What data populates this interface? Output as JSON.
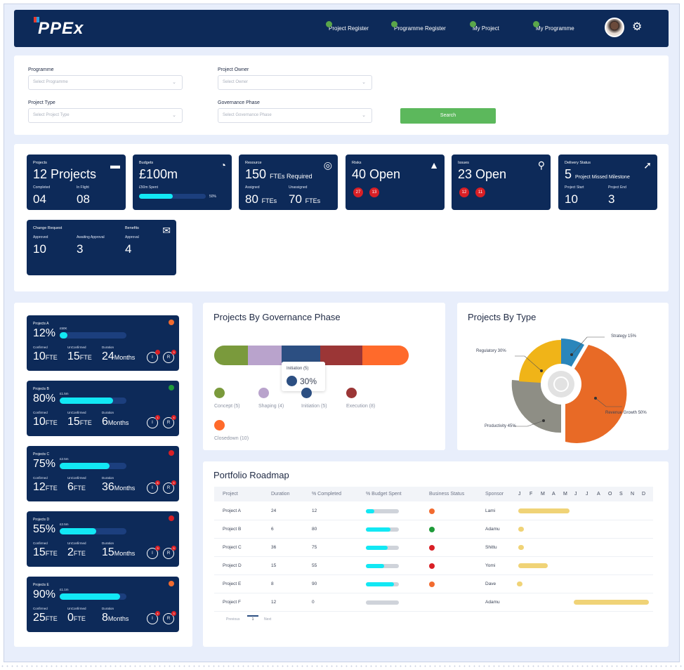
{
  "header": {
    "logo": "PPEx",
    "nav": [
      {
        "label": "Project Register"
      },
      {
        "label": "Programme Register"
      },
      {
        "label": "My Project"
      },
      {
        "label": "My Programme"
      }
    ]
  },
  "filters": {
    "programme": {
      "label": "Programme",
      "placeholder": "Select Programme"
    },
    "project_owner": {
      "label": "Project Owner",
      "placeholder": "Select Owner"
    },
    "project_type": {
      "label": "Project Type",
      "placeholder": "Select Project Type"
    },
    "governance_phase": {
      "label": "Governance Phase",
      "placeholder": "Select Governance Phase"
    },
    "search_label": "Search"
  },
  "kpis": {
    "projects": {
      "title": "Projects",
      "value": "12 Projects",
      "completed_label": "Completed",
      "completed": "04",
      "inflight_label": "In Flight",
      "inflight": "08"
    },
    "budgets": {
      "title": "Budgets",
      "value": "£100m",
      "spent_label": "£50m Spent",
      "spent_pct_label": "50%",
      "spent_fraction": 0.5
    },
    "resource": {
      "title": "Resource",
      "value": "150",
      "value_unit": "FTEs Required",
      "assigned_label": "Assigned",
      "assigned": "80",
      "assigned_unit": "FTEs",
      "unassigned_label": "Unassigned",
      "unassigned": "70",
      "unassigned_unit": "FTEs"
    },
    "risks": {
      "title": "Risks",
      "value": "40 Open",
      "badge1": "27",
      "badge2": "13"
    },
    "issues": {
      "title": "Issues",
      "value": "23 Open",
      "badge1": "12",
      "badge2": "11"
    },
    "delivery": {
      "title": "Delivery Status",
      "value": "5",
      "value_unit": "Project Missed Milestone",
      "start_label": "Project Start",
      "start": "10",
      "end_label": "Project End",
      "end": "3"
    },
    "change": {
      "title": "Change Request",
      "approved_label": "Approved",
      "approved": "10",
      "awaiting_label": "Awaiting Approval",
      "awaiting": "3",
      "benefits_title": "Benefits",
      "benefits_approval_label": "Approval",
      "benefits": "4"
    }
  },
  "project_cards": [
    {
      "name": "Projects A",
      "pct": "12%",
      "fraction": 0.12,
      "amount": "£50K",
      "confirmed": "10",
      "unconfirmed": "15",
      "duration": "24",
      "status_color": "#f26b2f",
      "i_badge": "",
      "r_badge": "3"
    },
    {
      "name": "Projects B",
      "pct": "80%",
      "fraction": 0.8,
      "amount": "£1.5m",
      "confirmed": "10",
      "unconfirmed": "15",
      "duration": "6",
      "status_color": "#1f9b3a",
      "i_badge": "1",
      "r_badge": "4"
    },
    {
      "name": "Projects C",
      "pct": "75%",
      "fraction": 0.75,
      "amount": "£2.5m",
      "confirmed": "12",
      "unconfirmed": "6",
      "duration": "36",
      "status_color": "#d91f25",
      "i_badge": "8",
      "r_badge": "5"
    },
    {
      "name": "Projects D",
      "pct": "55%",
      "fraction": 0.55,
      "amount": "£2.5m",
      "confirmed": "15",
      "unconfirmed": "2",
      "duration": "15",
      "status_color": "#d91f25",
      "i_badge": "3",
      "r_badge": "5"
    },
    {
      "name": "Projects E",
      "pct": "90%",
      "fraction": 0.9,
      "amount": "£1.1m",
      "confirmed": "25",
      "unconfirmed": "0",
      "duration": "8",
      "status_color": "#f26b2f",
      "i_badge": "4",
      "r_badge": "3"
    }
  ],
  "card_labels": {
    "confirmed": "Confirmed",
    "unconfirmed": "UnConfirmed",
    "duration": "Duration",
    "fte": "FTE",
    "months": "Months",
    "i": "I",
    "r": "R"
  },
  "governance": {
    "title": "Projects By Governance Phase",
    "tooltip_label": "Initiation (5)",
    "tooltip_value": "30%",
    "phases": [
      {
        "label": "Concept (5)",
        "color": "#7a9a3c"
      },
      {
        "label": "Shaping (4)",
        "color": "#b9a3cc"
      },
      {
        "label": "Initiation (5)",
        "color": "#2c4f82"
      },
      {
        "label": "Execution (8)",
        "color": "#9b3636"
      },
      {
        "label": "Closedown (10)",
        "color": "#ff6a2b"
      }
    ]
  },
  "types": {
    "title": "Projects By Type",
    "labels": {
      "strategy": "Strategy 15%",
      "regulatory": "Regulatory 30%",
      "revenue": "Revenue Growth 50%",
      "productivity": "Productivity 45%"
    }
  },
  "roadmap": {
    "title": "Portfolio Roadmap",
    "headers": [
      "Project",
      "Duration",
      "% Completed",
      "% Budget Spent",
      "Business Status",
      "Sponsor"
    ],
    "months": [
      "J",
      "F",
      "M",
      "A",
      "M",
      "J",
      "J",
      "A",
      "O",
      "S",
      "N",
      "D"
    ],
    "rows": [
      {
        "project": "Project A",
        "duration": "24",
        "completed": "12",
        "budget_fraction": 0.25,
        "status_color": "#f26b2f",
        "sponsor": "Lami"
      },
      {
        "project": "Project B",
        "duration": "6",
        "completed": "80",
        "budget_fraction": 0.75,
        "status_color": "#1f9b3a",
        "sponsor": "Adamu"
      },
      {
        "project": "Project C",
        "duration": "36",
        "completed": "75",
        "budget_fraction": 0.65,
        "status_color": "#d91f25",
        "sponsor": "Shittu"
      },
      {
        "project": "Project D",
        "duration": "15",
        "completed": "55",
        "budget_fraction": 0.55,
        "status_color": "#d91f25",
        "sponsor": "Yomi"
      },
      {
        "project": "Project E",
        "duration": "8",
        "completed": "90",
        "budget_fraction": 0.85,
        "status_color": "#f26b2f",
        "sponsor": "Dave"
      },
      {
        "project": "Project F",
        "duration": "12",
        "completed": "0",
        "budget_fraction": 0,
        "status_color": "",
        "sponsor": "Adamu"
      }
    ],
    "pagination": {
      "prev": "Previous",
      "page": "1",
      "next": "Next"
    }
  }
}
